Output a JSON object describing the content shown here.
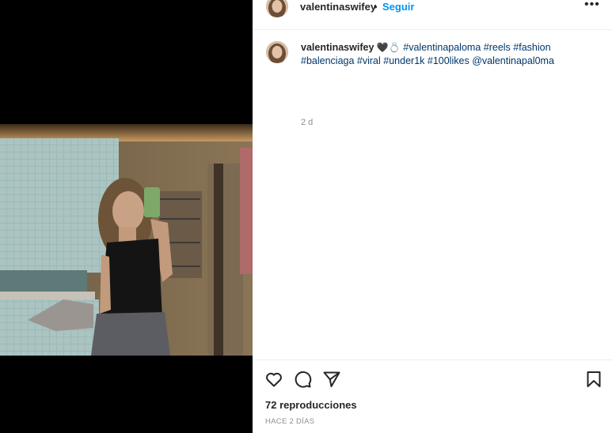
{
  "header": {
    "username": "valentinaswifey",
    "separator": "•",
    "follow_label": "Seguir",
    "more_label": "•••"
  },
  "caption": {
    "username": "valentinaswifey",
    "emoji_heart": "🖤",
    "emoji_ring": "💍",
    "hashtags_line1": [
      "#valentinapaloma",
      "#reels",
      "#fashion"
    ],
    "hashtags_line2": [
      "#balenciaga",
      "#viral",
      "#under1k",
      "#100likes"
    ],
    "mention": "@valentinapal0ma",
    "age": "2 d"
  },
  "actions": {
    "like_icon": "heart-outline-icon",
    "comment_icon": "comment-bubble-icon",
    "share_icon": "paper-plane-icon",
    "save_icon": "bookmark-icon"
  },
  "stats": {
    "views": "72 reproducciones",
    "posted": "HACE 2 DÍAS"
  },
  "colors": {
    "follow_blue": "#0095f6",
    "hashtag": "#00376b",
    "text": "#262626",
    "muted": "#8e8e8e",
    "media_bg": "#000000"
  }
}
